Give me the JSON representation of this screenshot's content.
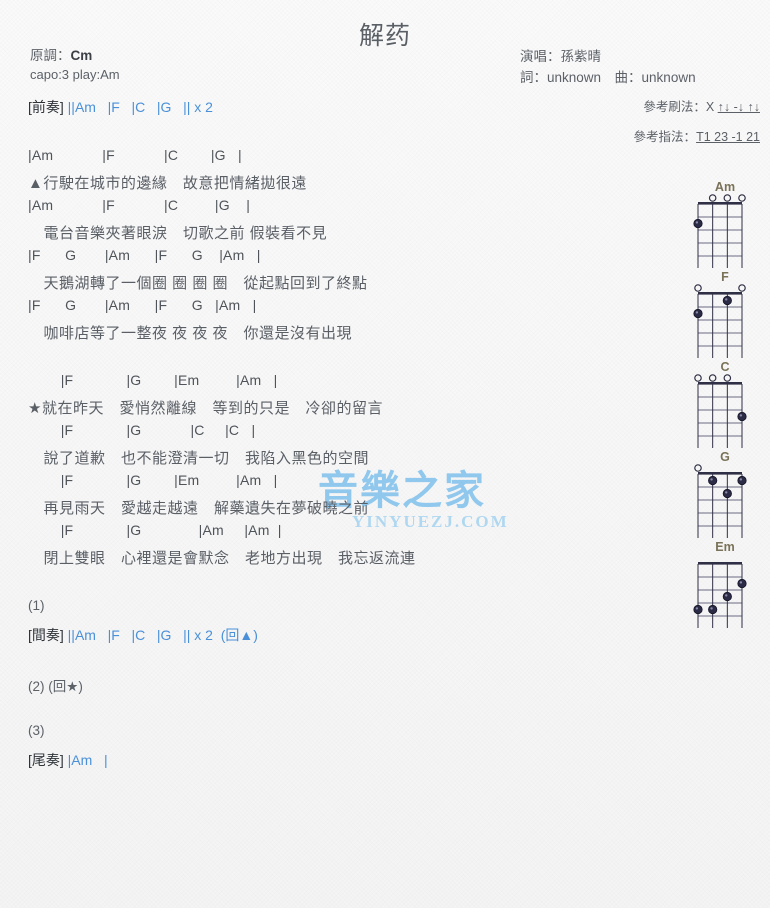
{
  "title": "解药",
  "meta_left": {
    "orig_key_label": "原調：",
    "orig_key_value": "Cm",
    "capo": "capo:3 play:Am"
  },
  "meta_right": {
    "singer": "演唱：孫紫晴",
    "writers": "詞：unknown　曲：unknown",
    "strum_label": "參考刷法：",
    "strum_pattern_plain": "X ",
    "strum_pattern_underlined": "↑↓ -↓ ↑↓",
    "finger_label": "參考指法：",
    "finger_pattern": "T1 23 -1 21"
  },
  "watermark": {
    "main": "音樂之家",
    "sub": "YINYUEZJ.COM"
  },
  "sections": [
    {
      "id": "prelude",
      "tag": "[前奏]",
      "bars": "||Am   |F   |C   |G   || x 2",
      "plain_chords": [
        "Am",
        "F",
        "C",
        "G"
      ],
      "repeat": "x 2"
    },
    {
      "id": "verse1",
      "lines": [
        {
          "type": "chord",
          "text": "|Am            |F            |C        |G   |"
        },
        {
          "type": "lyric",
          "text": "▲行駛在城市的邊緣　故意把情緒拋很遠"
        },
        {
          "type": "chord",
          "text": "|Am            |F            |C         |G    |"
        },
        {
          "type": "lyric",
          "text": "　電台音樂夾著眼淚　切歌之前 假裝看不見"
        },
        {
          "type": "chord",
          "text": "|F      G       |Am      |F      G    |Am   |"
        },
        {
          "type": "lyric",
          "text": "　天鵝湖轉了一個圈 圈 圈 圈　從起點回到了終點"
        },
        {
          "type": "chord",
          "text": "|F      G       |Am      |F      G   |Am   |"
        },
        {
          "type": "lyric",
          "text": "　咖啡店等了一整夜 夜 夜 夜　你還是沒有出現"
        }
      ]
    },
    {
      "id": "chorus",
      "lines": [
        {
          "type": "chord",
          "text": "        |F             |G        |Em         |Am   |"
        },
        {
          "type": "lyric",
          "text": "★就在昨天　愛悄然離線　等到的只是　冷卻的留言"
        },
        {
          "type": "chord",
          "text": "        |F             |G            |C     |C   |"
        },
        {
          "type": "lyric",
          "text": "　說了道歉　也不能澄清一切　我陷入黑色的空間"
        },
        {
          "type": "chord",
          "text": "        |F             |G        |Em         |Am   |"
        },
        {
          "type": "lyric",
          "text": "　再見雨天　愛越走越遠　解藥遺失在夢破曉之前"
        },
        {
          "type": "chord",
          "text": "        |F             |G              |Am     |Am  |"
        },
        {
          "type": "lyric",
          "text": "　閉上雙眼　心裡還是會默念　老地方出現　我忘返流連"
        }
      ]
    },
    {
      "id": "interlude",
      "number": "(1)",
      "tag": "[間奏]",
      "bars": "||Am   |F   |C   |G   || x 2  (回▲)",
      "plain_chords": [
        "Am",
        "F",
        "C",
        "G"
      ],
      "repeat": "x 2",
      "back_to": "(回▲)"
    },
    {
      "id": "repeat2",
      "number": "(2)",
      "back_to": "(回★)"
    },
    {
      "id": "outro",
      "number": "(3)",
      "tag": "[尾奏]",
      "bars": "|Am   |"
    }
  ],
  "chord_diagrams": [
    {
      "name": "Am",
      "open_strings": [
        2,
        3,
        4
      ],
      "muted_strings": [],
      "dots": [
        {
          "string": 1,
          "fret": 2
        }
      ]
    },
    {
      "name": "F",
      "open_strings": [
        1,
        4
      ],
      "muted_strings": [],
      "dots": [
        {
          "string": 1,
          "fret": 2
        },
        {
          "string": 3,
          "fret": 1
        }
      ]
    },
    {
      "name": "C",
      "open_strings": [
        1,
        2,
        3
      ],
      "muted_strings": [],
      "dots": [
        {
          "string": 4,
          "fret": 3
        }
      ]
    },
    {
      "name": "G",
      "open_strings": [
        1
      ],
      "muted_strings": [],
      "dots": [
        {
          "string": 2,
          "fret": 1
        },
        {
          "string": 4,
          "fret": 1
        },
        {
          "string": 3,
          "fret": 2
        }
      ]
    },
    {
      "name": "Em",
      "open_strings": [],
      "muted_strings": [],
      "dots": [
        {
          "string": 4,
          "fret": 2
        },
        {
          "string": 3,
          "fret": 3
        },
        {
          "string": 1,
          "fret": 4
        },
        {
          "string": 2,
          "fret": 4
        }
      ]
    }
  ],
  "colors": {
    "chord_blue": "#4a90d9",
    "text_gray": "#5a5f66",
    "diagram_label": "#7a7258",
    "watermark_blue": "#49a8e8"
  }
}
